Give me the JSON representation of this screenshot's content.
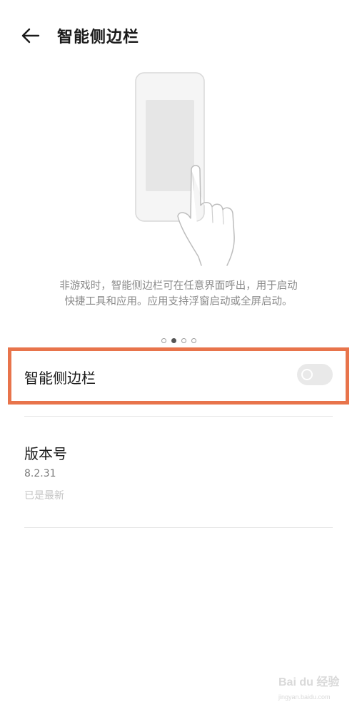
{
  "header": {
    "back_icon": "arrow-left-icon",
    "title": "智能侧边栏"
  },
  "illustration": {
    "icon": "phone-swipe-gesture-icon"
  },
  "description": {
    "line1": "非游戏时，智能侧边栏可在任意界面呼出，用于启动",
    "line2": "快捷工具和应用。应用支持浮窗启动或全屏启动。"
  },
  "pager": {
    "count": 4,
    "active_index": 1
  },
  "setting": {
    "label": "智能侧边栏",
    "enabled": false,
    "highlight_color": "#e8744b"
  },
  "version": {
    "title": "版本号",
    "number": "8.2.31",
    "status": "已是最新"
  },
  "watermark": {
    "brand": "Bai du 经验",
    "url": "jingyan.baidu.com"
  }
}
